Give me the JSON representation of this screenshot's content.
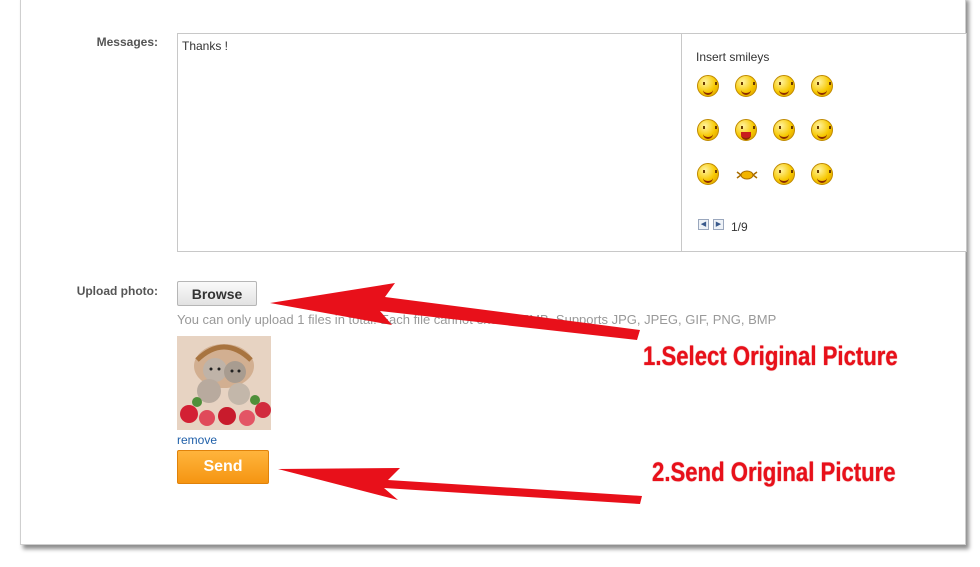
{
  "messages": {
    "label": "Messages:",
    "text": "Thanks !",
    "smileys": {
      "title": "Insert smileys",
      "items": [
        "smile",
        "drool",
        "tongue",
        "giggle",
        "whistle",
        "shout",
        "laugh-cry",
        "blush",
        "cringe",
        "crab",
        "hide",
        "grin"
      ],
      "page": "1/9"
    }
  },
  "upload": {
    "label": "Upload photo:",
    "browse_label": "Browse",
    "hint": "You can only upload 1 files in total. Each file cannot exceed 5MB, Supports JPG, JPEG, GIF, PNG, BMP",
    "remove_label": "remove",
    "send_label": "Send"
  },
  "annotations": {
    "step1": "1.Select Original Picture",
    "step2": "2.Send Original Picture",
    "color": "#e8101a"
  },
  "colors": {
    "send_button": "#f59512",
    "link": "#1f5fa8"
  }
}
